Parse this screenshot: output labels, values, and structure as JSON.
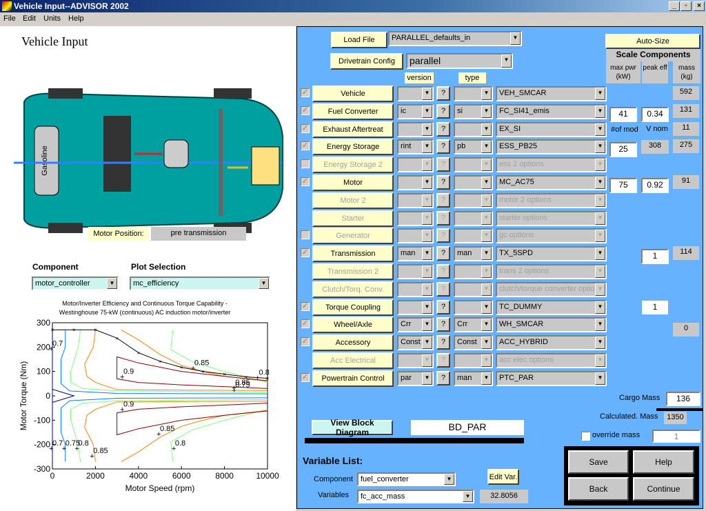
{
  "window": {
    "title": "Vehicle Input--ADVISOR 2002"
  },
  "menu": [
    "File",
    "Edit",
    "Units",
    "Help"
  ],
  "left": {
    "heading": "Vehicle Input",
    "car_image": {
      "fuel_tank_label": "Gasoline",
      "body_color": "#00a0a0"
    },
    "motor_position_label": "Motor Position:",
    "motor_position_value": "pre transmission",
    "component_label": "Component",
    "plot_selection_label": "Plot Selection",
    "component_value": "motor_controller",
    "plot_value": "mc_efficiency"
  },
  "chart_data": {
    "type": "line",
    "title": "Motor/Inverter Efficiency and Continuous Torque Capability -",
    "subtitle": "Westinghouse 75-kW (continuous) AC induction motor/inverter",
    "xlabel": "Motor Speed (rpm)",
    "ylabel": "Motor Torque (Nm)",
    "xlim": [
      0,
      10000
    ],
    "ylim": [
      -300,
      300
    ],
    "xticks": [
      "0",
      "2000",
      "4000",
      "6000",
      "8000",
      "10000"
    ],
    "yticks": [
      "300",
      "200",
      "100",
      "0",
      "-100",
      "-200",
      "-300"
    ],
    "grid": false,
    "torque_capability": {
      "color": "#000000",
      "x": [
        0,
        1000,
        2000,
        3000,
        4000,
        5000,
        6000,
        7000,
        8000,
        9000,
        10000
      ],
      "y": [
        271,
        271,
        271,
        237,
        177,
        142,
        117,
        100,
        89,
        78,
        72
      ]
    },
    "contours": [
      {
        "level": 0.7,
        "color": "#000090",
        "x": [
          0,
          1000,
          0
        ],
        "y": [
          27,
          0,
          -27
        ]
      },
      {
        "level": 0.7,
        "color": "#000090",
        "x": [
          0,
          0
        ],
        "y": [
          -270,
          270
        ]
      },
      {
        "level": 0.75,
        "color": "#0080ff",
        "x": [
          600,
          600,
          400,
          400,
          800,
          3000,
          10000
        ],
        "y": [
          270,
          200,
          150,
          50,
          20,
          10,
          8
        ]
      },
      {
        "level": 0.75,
        "color": "#0080ff",
        "x": [
          600,
          600,
          400,
          400,
          800,
          3000,
          10000
        ],
        "y": [
          -270,
          -200,
          -150,
          -50,
          -20,
          -10,
          -8
        ]
      },
      {
        "level": 0.8,
        "color": "#80ff80",
        "x": [
          1300,
          1200,
          850,
          850,
          1400,
          3000,
          10000
        ],
        "y": [
          270,
          200,
          100,
          55,
          30,
          20,
          15
        ]
      },
      {
        "level": 0.8,
        "color": "#80ff80",
        "x": [
          1300,
          1200,
          850,
          850,
          1400,
          3000,
          10000
        ],
        "y": [
          -270,
          -200,
          -100,
          -55,
          -30,
          -20,
          -15
        ]
      },
      {
        "level": 0.8,
        "color": "#80ff80",
        "x": [
          5600,
          5500,
          6500,
          8000,
          10000
        ],
        "y": [
          270,
          190,
          140,
          100,
          55
        ]
      },
      {
        "level": 0.8,
        "color": "#80ff80",
        "x": [
          5600,
          5500,
          6500,
          8000,
          10000
        ],
        "y": [
          -270,
          -190,
          -140,
          -100,
          -55
        ]
      },
      {
        "level": 0.85,
        "color": "#ff8000",
        "x": [
          2000,
          1900,
          1500,
          1600,
          2000,
          3000,
          10000
        ],
        "y": [
          270,
          200,
          130,
          80,
          55,
          25,
          22
        ]
      },
      {
        "level": 0.85,
        "color": "#ff8000",
        "x": [
          2000,
          1900,
          1500,
          1600,
          2000,
          3000,
          10000
        ],
        "y": [
          -270,
          -200,
          -130,
          -80,
          -55,
          -25,
          -22
        ]
      },
      {
        "level": 0.85,
        "color": "#ff8000",
        "x": [
          3200,
          4000,
          5000,
          6000,
          7000,
          8000,
          10000
        ],
        "y": [
          270,
          230,
          170,
          125,
          100,
          80,
          60
        ]
      },
      {
        "level": 0.85,
        "color": "#ff8000",
        "x": [
          3200,
          4000,
          5000,
          6000,
          7000,
          8000,
          10000
        ],
        "y": [
          -270,
          -230,
          -170,
          -125,
          -100,
          -80,
          -60
        ]
      },
      {
        "level": 0.9,
        "color": "#900000",
        "x": [
          10000,
          8000,
          6000,
          4000,
          3000,
          3000,
          4000,
          6000,
          8000,
          10000
        ],
        "y": [
          62,
          80,
          100,
          135,
          160,
          70,
          55,
          45,
          38,
          30
        ]
      },
      {
        "level": 0.9,
        "color": "#900000",
        "x": [
          10000,
          8000,
          6000,
          4000,
          3000,
          3000,
          4000,
          6000,
          8000,
          10000
        ],
        "y": [
          -62,
          -80,
          -100,
          -135,
          -160,
          -70,
          -55,
          -45,
          -38,
          -30
        ]
      }
    ],
    "labels": [
      {
        "text": "0.7",
        "x": 0,
        "y": 200
      },
      {
        "text": "0.9",
        "x": 3300,
        "y": 85
      },
      {
        "text": "0.85",
        "x": 6600,
        "y": 120
      },
      {
        "text": "0.8",
        "x": 9600,
        "y": 80
      },
      {
        "text": "0.85",
        "x": 8500,
        "y": 40
      },
      {
        "text": "0.75",
        "x": 8500,
        "y": 30
      },
      {
        "text": "0.9",
        "x": 3300,
        "y": -50
      },
      {
        "text": "0.85",
        "x": 5000,
        "y": -150
      },
      {
        "text": "0.8",
        "x": 5700,
        "y": -210
      },
      {
        "text": "0.7",
        "x": 0,
        "y": -210
      },
      {
        "text": "0.75",
        "x": 600,
        "y": -210
      },
      {
        "text": "0.8",
        "x": 1200,
        "y": -210
      },
      {
        "text": "0.85",
        "x": 1900,
        "y": -240
      }
    ]
  },
  "right": {
    "load_file_label": "Load File",
    "load_file_value": "PARALLEL_defaults_in",
    "drivetrain_label": "Drivetrain Config",
    "drivetrain_value": "parallel",
    "version_label": "version",
    "type_label": "type",
    "autosize_label": "Auto-Size",
    "scale_title": "Scale Components",
    "col_maxpwr": "max pwr (kW)",
    "col_peakeff": "peak eff",
    "col_mass": "mass (kg)",
    "numod_label": "#of mod",
    "vnom_label": "V nom",
    "rows": [
      {
        "name": "Vehicle",
        "enabled": true,
        "checkbox": "checked",
        "version": "",
        "type": "",
        "file": "VEH_SMCAR",
        "c1": "",
        "c2": "",
        "mass": "592"
      },
      {
        "name": "Fuel Converter",
        "enabled": true,
        "checkbox": "checked",
        "version": "ic",
        "type": "si",
        "file": "FC_SI41_emis",
        "c1": "41",
        "c2": "0.34",
        "mass": "131"
      },
      {
        "name": "Exhaust Aftertreat",
        "enabled": true,
        "checkbox": "checked",
        "version": "",
        "type": "",
        "file": "EX_SI",
        "c1": "",
        "c2": "",
        "mass": "11"
      },
      {
        "name": "Energy Storage",
        "enabled": true,
        "checkbox": "checked",
        "version": "rint",
        "type": "pb",
        "file": "ESS_PB25",
        "c1": "25",
        "c2g": "308",
        "mass": "275"
      },
      {
        "name": "Energy Storage 2",
        "enabled": false,
        "checkbox": "unchecked",
        "version": "",
        "type": "",
        "file": "ess 2 options"
      },
      {
        "name": "Motor",
        "enabled": true,
        "checkbox": "checked",
        "version": "",
        "type": "",
        "file": "MC_AC75",
        "c1": "75",
        "c2": "0.92",
        "mass": "91"
      },
      {
        "name": "Motor 2",
        "enabled": false,
        "checkbox": "none",
        "version": "",
        "type": "",
        "file": "motor 2 options"
      },
      {
        "name": "Starter",
        "enabled": false,
        "checkbox": "none",
        "version": "",
        "type": "",
        "file": "starter options"
      },
      {
        "name": "Generator",
        "enabled": false,
        "checkbox": "unchecked",
        "version": "",
        "type": "",
        "file": "gc options"
      },
      {
        "name": "Transmission",
        "enabled": true,
        "checkbox": "checked",
        "version": "man",
        "type": "man",
        "file": "TX_5SPD",
        "c2": "1",
        "mass": "114"
      },
      {
        "name": "Transmission 2",
        "enabled": false,
        "checkbox": "none",
        "version": "",
        "type": "",
        "file": "trans 2 options"
      },
      {
        "name": "Clutch/Torq. Conv.",
        "enabled": false,
        "checkbox": "none",
        "version": "",
        "type": "",
        "file": "clutch/torque converter optio"
      },
      {
        "name": "Torque Coupling",
        "enabled": true,
        "checkbox": "checked",
        "version": "",
        "type": "",
        "file": "TC_DUMMY",
        "c2w": "1"
      },
      {
        "name": "Wheel/Axle",
        "enabled": true,
        "checkbox": "checked",
        "version": "Crr",
        "type": "Crr",
        "file": "WH_SMCAR",
        "massLow": "0"
      },
      {
        "name": "Accessory",
        "enabled": true,
        "checkbox": "checked",
        "version": "Const",
        "type": "Const",
        "file": "ACC_HYBRID"
      },
      {
        "name": "Acc Electrical",
        "enabled": false,
        "checkbox": "none",
        "version": "",
        "type": "",
        "file": "acc elec options"
      },
      {
        "name": "Powertrain Control",
        "enabled": true,
        "checkbox": "checked",
        "version": "par",
        "type": "man",
        "file": "PTC_PAR"
      }
    ],
    "cargo_mass_label": "Cargo Mass",
    "cargo_mass": "136",
    "calc_mass_label": "Calculated. Mass",
    "calc_mass": "1350",
    "override_label": "override mass",
    "override_value": "1",
    "view_block_label": "View Block Diagram",
    "block_diagram": "BD_PAR",
    "varlist_title": "Variable List:",
    "var_component_label": "Component",
    "var_component": "fuel_converter",
    "var_variables_label": "Variables",
    "var_variable": "fc_acc_mass",
    "edit_var_label": "Edit Var.",
    "var_value": "32.8056",
    "save": "Save",
    "help": "Help",
    "back": "Back",
    "continue": "Continue"
  }
}
